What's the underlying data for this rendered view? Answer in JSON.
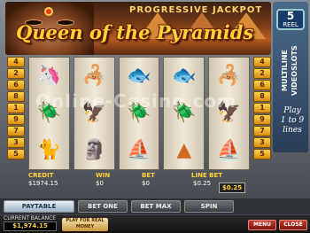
{
  "header": {
    "progressive_label": "PROGRESSIVE JACKPOT",
    "title": "Queen of the Pyramids"
  },
  "side_panel": {
    "reel_count": "5",
    "reel_word": "REEL",
    "multiline_label": "MULTILINE VIDEOSLOTS",
    "play_label": "Play",
    "play_range": "1 to 9",
    "lines_label": "lines"
  },
  "paylines_left": [
    "4",
    "2",
    "6",
    "8",
    "1",
    "9",
    "7",
    "3",
    "5"
  ],
  "paylines_right": [
    "4",
    "2",
    "6",
    "8",
    "1",
    "9",
    "7",
    "3",
    "5"
  ],
  "reels": [
    [
      {
        "icon": "unicorn-icon",
        "glyph": "🦄",
        "cls": "uni"
      },
      {
        "icon": "scarab-icon",
        "glyph": "🪲",
        "cls": "scarab"
      },
      {
        "icon": "cat-statue-icon",
        "glyph": "🐈",
        "cls": "cat"
      }
    ],
    [
      {
        "icon": "scorpion-icon",
        "glyph": "🦂",
        "cls": "scor"
      },
      {
        "icon": "bird-icon",
        "glyph": "🦅",
        "cls": "bird"
      },
      {
        "icon": "sphinx-icon",
        "glyph": "🗿",
        "cls": "sphinx"
      }
    ],
    [
      {
        "icon": "fish-icon",
        "glyph": "🐟",
        "cls": "fish"
      },
      {
        "icon": "scarab-icon",
        "glyph": "🪲",
        "cls": "scarab"
      },
      {
        "icon": "boat-icon",
        "glyph": "⛵",
        "cls": "boat"
      }
    ],
    [
      {
        "icon": "fish-icon",
        "glyph": "🐟",
        "cls": "fish"
      },
      {
        "icon": "scarab-icon",
        "glyph": "🪲",
        "cls": "scarab"
      },
      {
        "icon": "pyramid-icon",
        "glyph": "▲",
        "cls": "pyrg"
      }
    ],
    [
      {
        "icon": "scorpion-icon",
        "glyph": "🦂",
        "cls": "scor"
      },
      {
        "icon": "bird-icon",
        "glyph": "🦅",
        "cls": "bird"
      },
      {
        "icon": "boat-icon",
        "glyph": "⛵",
        "cls": "boat"
      }
    ]
  ],
  "watermark": "Online-Casino.com",
  "info": {
    "credit_label": "CREDIT",
    "credit_value": "$1974.15",
    "win_label": "WIN",
    "win_value": "$0",
    "bet_label": "BET",
    "bet_value": "$0",
    "line_bet_label": "LINE BET",
    "line_bet_value": "$0.25",
    "bet_box": "$0.25"
  },
  "buttons": {
    "paytable": "PAYTABLE",
    "bet_one": "BET ONE",
    "bet_max": "BET MAX",
    "spin": "SPIN"
  },
  "bottom": {
    "balance_label": "CURRENT BALANCE",
    "balance_value": "$1,974.15",
    "realm_label": "PLAY FOR REAL MONEY",
    "menu": "MENU",
    "close": "CLOSE"
  },
  "colors": {
    "title": "#ffd23a",
    "line_number": "#ffd84a",
    "panel": "#2a3e58"
  }
}
